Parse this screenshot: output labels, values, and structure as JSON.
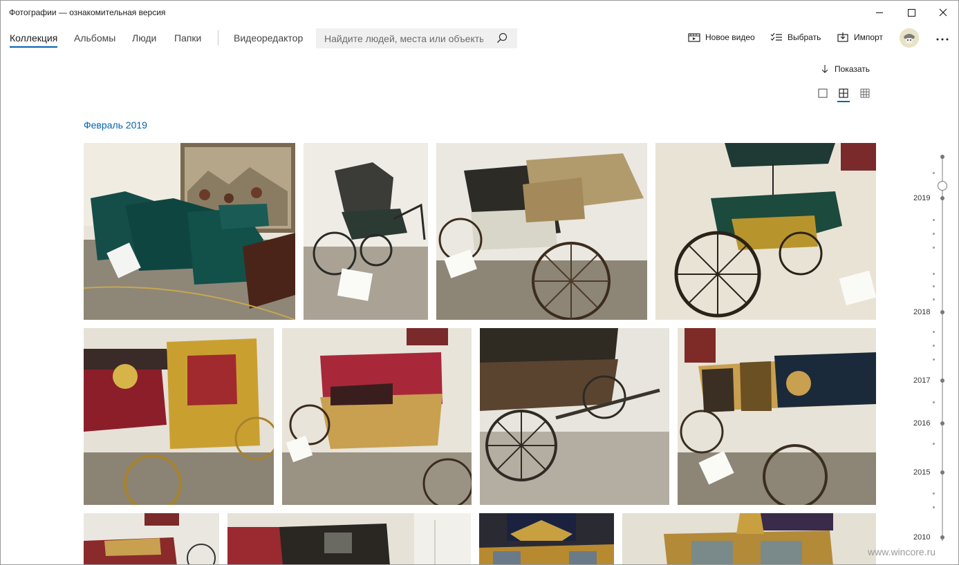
{
  "window": {
    "title": "Фотографии — ознакомительная версия"
  },
  "nav": {
    "tabs": [
      {
        "label": "Коллекция",
        "active": true
      },
      {
        "label": "Альбомы"
      },
      {
        "label": "Люди"
      },
      {
        "label": "Папки"
      }
    ],
    "video_editor": "Видеоредактор"
  },
  "search": {
    "placeholder": "Найдите людей, места или объекты"
  },
  "actions": {
    "new_video": "Новое видео",
    "select": "Выбрать",
    "import": "Импорт"
  },
  "view": {
    "show_label": "Показать",
    "selected_view": "medium"
  },
  "section": {
    "month": "Февраль 2019"
  },
  "timeline": {
    "years": [
      "2019",
      "2018",
      "2017",
      "2016",
      "2015",
      "2010"
    ]
  },
  "watermark": "www.wincore.ru",
  "colors": {
    "accent": "#0063b1"
  },
  "photos": [
    {
      "id": "sleighs",
      "icon": "photo-thumbnail"
    },
    {
      "id": "small-carriage",
      "icon": "photo-thumbnail"
    },
    {
      "id": "fringed-coach",
      "icon": "photo-thumbnail"
    },
    {
      "id": "umbrella-carriage",
      "icon": "photo-thumbnail"
    },
    {
      "id": "golden-coach",
      "icon": "photo-thumbnail"
    },
    {
      "id": "red-yellow-coach",
      "icon": "photo-thumbnail"
    },
    {
      "id": "coach-chassis",
      "icon": "photo-thumbnail"
    },
    {
      "id": "black-gold-coach",
      "icon": "photo-thumbnail"
    },
    {
      "id": "hall-carriages",
      "icon": "photo-thumbnail"
    },
    {
      "id": "dark-coach",
      "icon": "photo-thumbnail"
    },
    {
      "id": "eagle-coach",
      "icon": "photo-thumbnail"
    },
    {
      "id": "crown-coach",
      "icon": "photo-thumbnail"
    }
  ]
}
